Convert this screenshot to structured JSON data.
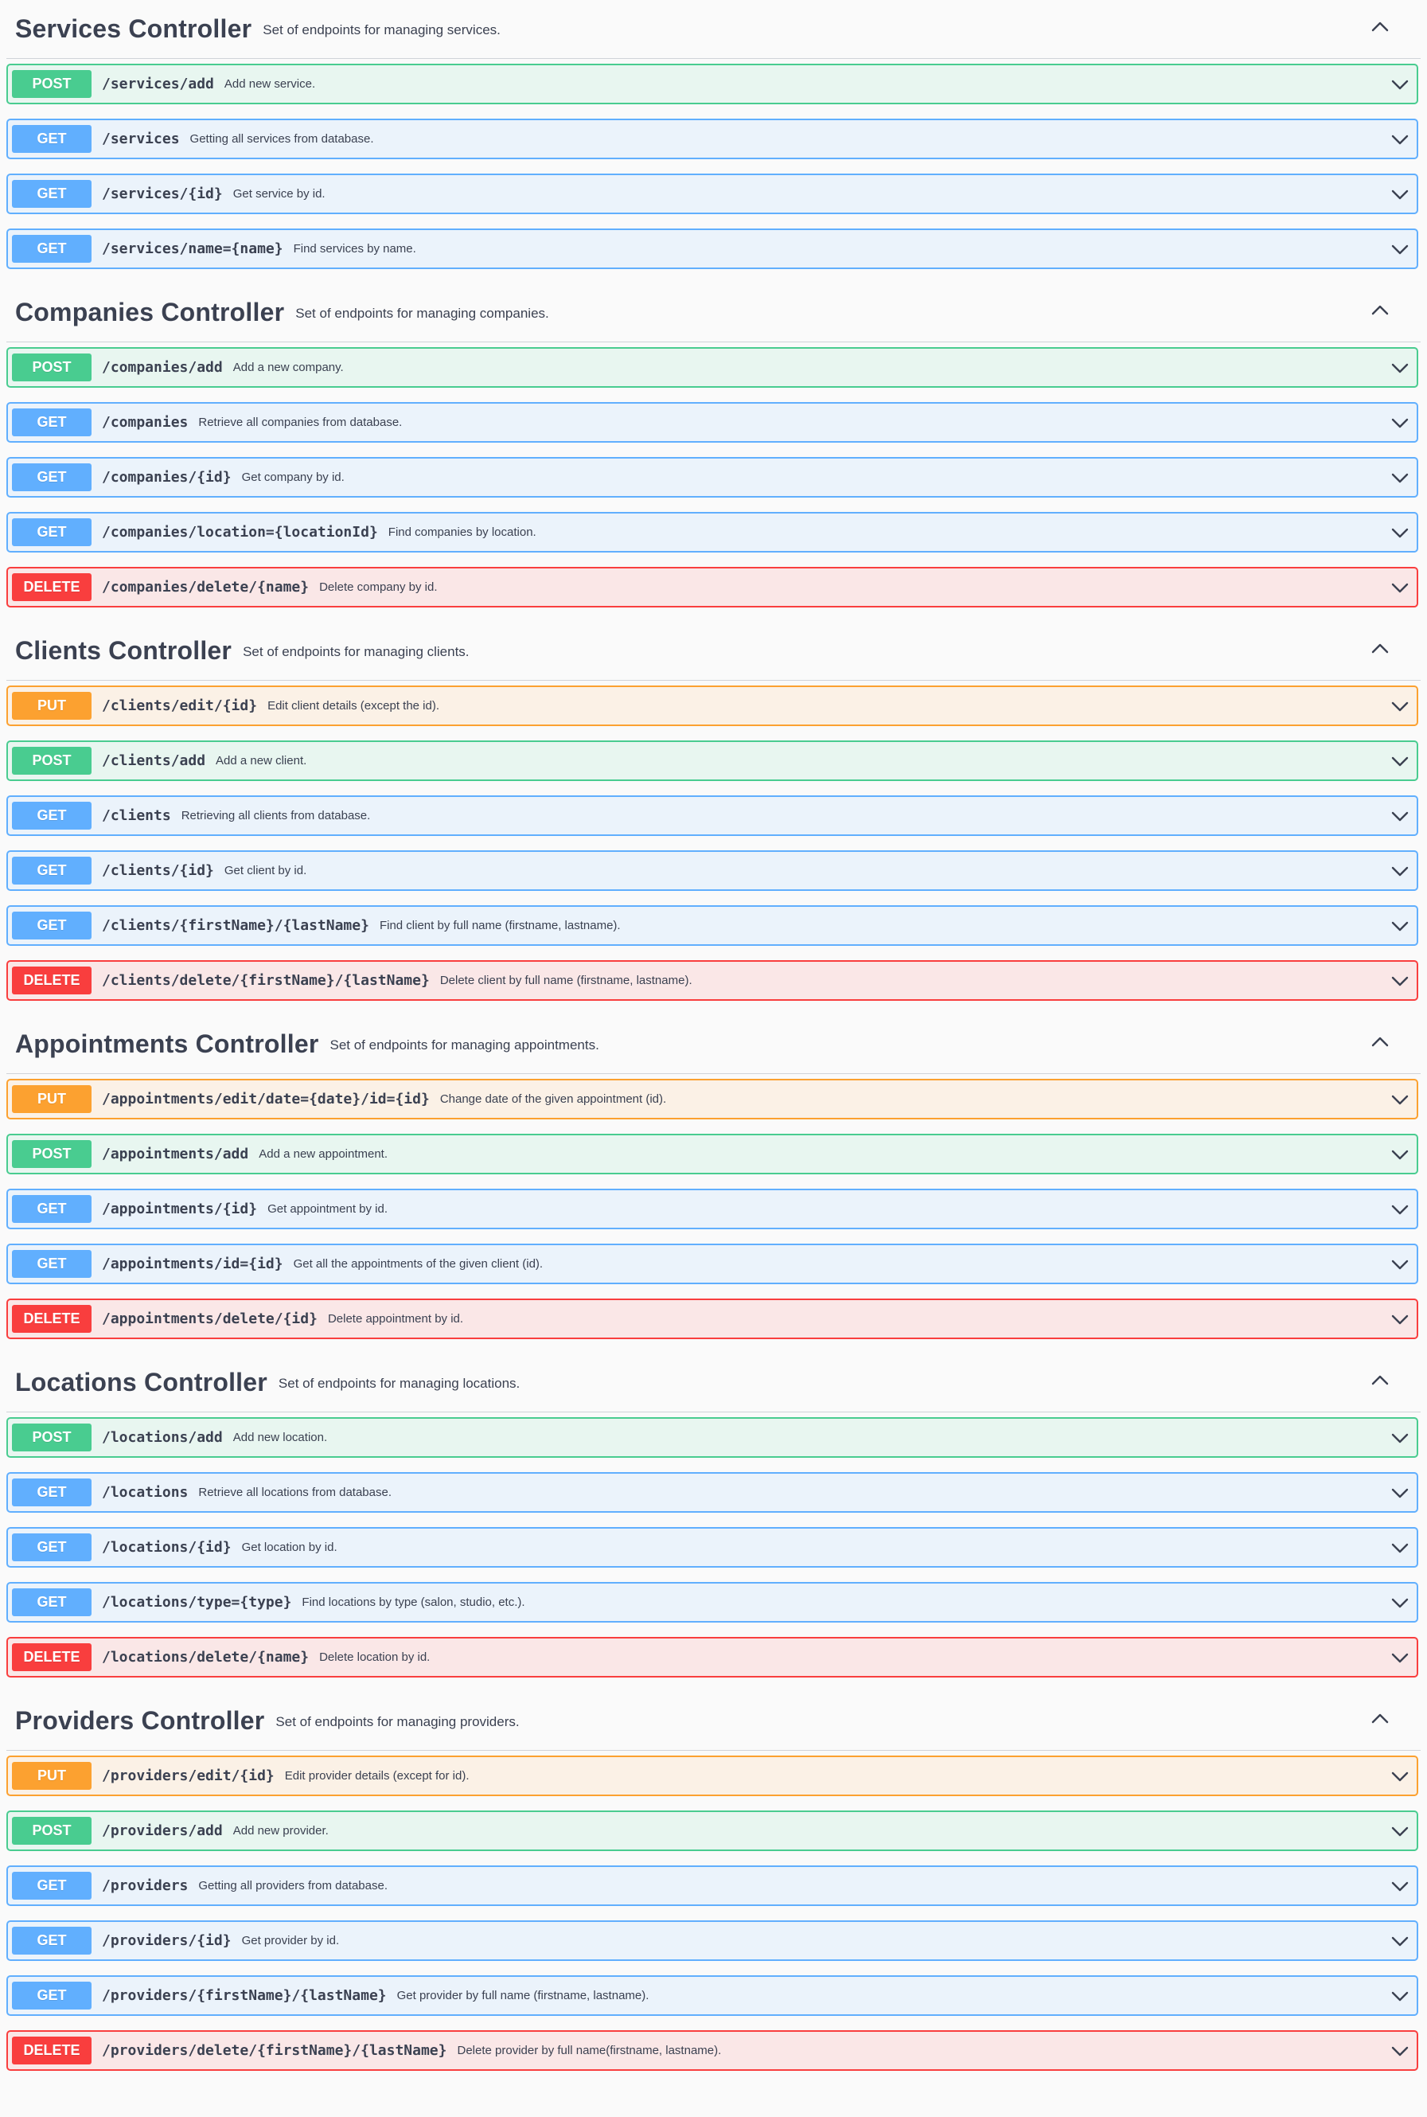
{
  "sections": [
    {
      "title": "Services Controller",
      "description": "Set of endpoints for managing services.",
      "operations": [
        {
          "method": "POST",
          "path": "/services/add",
          "summary": "Add new service."
        },
        {
          "method": "GET",
          "path": "/services",
          "summary": "Getting all services from database."
        },
        {
          "method": "GET",
          "path": "/services/{id}",
          "summary": "Get service by id."
        },
        {
          "method": "GET",
          "path": "/services/name={name}",
          "summary": "Find services by name."
        }
      ]
    },
    {
      "title": "Companies Controller",
      "description": "Set of endpoints for managing companies.",
      "operations": [
        {
          "method": "POST",
          "path": "/companies/add",
          "summary": "Add a new company."
        },
        {
          "method": "GET",
          "path": "/companies",
          "summary": "Retrieve all companies from database."
        },
        {
          "method": "GET",
          "path": "/companies/{id}",
          "summary": "Get company by id."
        },
        {
          "method": "GET",
          "path": "/companies/location={locationId}",
          "summary": "Find companies by location."
        },
        {
          "method": "DELETE",
          "path": "/companies/delete/{name}",
          "summary": "Delete company by id."
        }
      ]
    },
    {
      "title": "Clients Controller",
      "description": "Set of endpoints for managing clients.",
      "operations": [
        {
          "method": "PUT",
          "path": "/clients/edit/{id}",
          "summary": "Edit client details (except the id)."
        },
        {
          "method": "POST",
          "path": "/clients/add",
          "summary": "Add a new client."
        },
        {
          "method": "GET",
          "path": "/clients",
          "summary": "Retrieving all clients from database."
        },
        {
          "method": "GET",
          "path": "/clients/{id}",
          "summary": "Get client by id."
        },
        {
          "method": "GET",
          "path": "/clients/{firstName}/{lastName}",
          "summary": "Find client by full name (firstname, lastname)."
        },
        {
          "method": "DELETE",
          "path": "/clients/delete/{firstName}/{lastName}",
          "summary": "Delete client by full name (firstname, lastname)."
        }
      ]
    },
    {
      "title": "Appointments Controller",
      "description": "Set of endpoints for managing appointments.",
      "operations": [
        {
          "method": "PUT",
          "path": "/appointments/edit/date={date}/id={id}",
          "summary": "Change date of the given appointment (id)."
        },
        {
          "method": "POST",
          "path": "/appointments/add",
          "summary": "Add a new appointment."
        },
        {
          "method": "GET",
          "path": "/appointments/{id}",
          "summary": "Get appointment by id."
        },
        {
          "method": "GET",
          "path": "/appointments/id={id}",
          "summary": "Get all the appointments of the given client (id)."
        },
        {
          "method": "DELETE",
          "path": "/appointments/delete/{id}",
          "summary": "Delete appointment by id."
        }
      ]
    },
    {
      "title": "Locations Controller",
      "description": "Set of endpoints for managing locations.",
      "operations": [
        {
          "method": "POST",
          "path": "/locations/add",
          "summary": "Add new location."
        },
        {
          "method": "GET",
          "path": "/locations",
          "summary": "Retrieve all locations from database."
        },
        {
          "method": "GET",
          "path": "/locations/{id}",
          "summary": "Get location by id."
        },
        {
          "method": "GET",
          "path": "/locations/type={type}",
          "summary": "Find locations by type (salon, studio, etc.)."
        },
        {
          "method": "DELETE",
          "path": "/locations/delete/{name}",
          "summary": "Delete location by id."
        }
      ]
    },
    {
      "title": "Providers Controller",
      "description": "Set of endpoints for managing providers.",
      "operations": [
        {
          "method": "PUT",
          "path": "/providers/edit/{id}",
          "summary": "Edit provider details (except for id)."
        },
        {
          "method": "POST",
          "path": "/providers/add",
          "summary": "Add new provider."
        },
        {
          "method": "GET",
          "path": "/providers",
          "summary": "Getting all providers from database."
        },
        {
          "method": "GET",
          "path": "/providers/{id}",
          "summary": "Get provider by id."
        },
        {
          "method": "GET",
          "path": "/providers/{firstName}/{lastName}",
          "summary": "Get provider by full name (firstname, lastname)."
        },
        {
          "method": "DELETE",
          "path": "/providers/delete/{firstName}/{lastName}",
          "summary": "Delete provider by full name(firstname, lastname)."
        }
      ]
    }
  ],
  "icons": {
    "collapse": "chevron-up-icon",
    "expand": "chevron-down-icon"
  },
  "colors": {
    "post": "#49cc90",
    "get": "#61affe",
    "put": "#fca130",
    "delete": "#f93e3e"
  }
}
